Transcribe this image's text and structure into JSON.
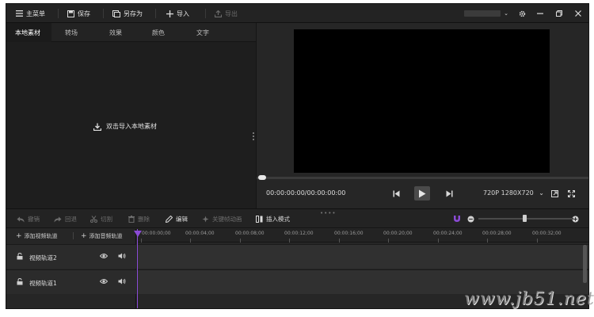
{
  "toolbar": {
    "main_menu": "主菜单",
    "save": "保存",
    "save_as": "另存为",
    "import": "导入",
    "export": "导出"
  },
  "media_panel": {
    "tabs": [
      "本地素材",
      "转场",
      "效果",
      "颜色",
      "文字"
    ],
    "active_tab_index": 0,
    "import_hint": "双击导入本地素材"
  },
  "player": {
    "time": "00:00:00:00/00:00:00:00",
    "resolution": "720P 1280X720",
    "progress": 0
  },
  "edit_toolbar": {
    "undo": "撤销",
    "redo": "回退",
    "cut": "切割",
    "delete": "删除",
    "edit": "编辑",
    "keyframe": "关键帧动画",
    "insert_mode": "插入模式"
  },
  "timeline": {
    "add_video_track": "添加视频轨道",
    "add_audio_track": "添加音频轨道",
    "ruler_labels": [
      "00:00:00;00",
      "00:00:04;00",
      "00:00:08;00",
      "00:00:12;00",
      "00:00:16;00",
      "00:00:20;00",
      "00:00:24;00",
      "00:00:28;00",
      "00:00:32;00"
    ],
    "tracks": [
      {
        "name": "视频轨道2"
      },
      {
        "name": "视频轨道1"
      }
    ],
    "zoom_level": 0.5
  },
  "watermark": "www.jb51.net",
  "colors": {
    "accent": "#8b4bd6",
    "background": "#262626",
    "preview": "#000000"
  }
}
